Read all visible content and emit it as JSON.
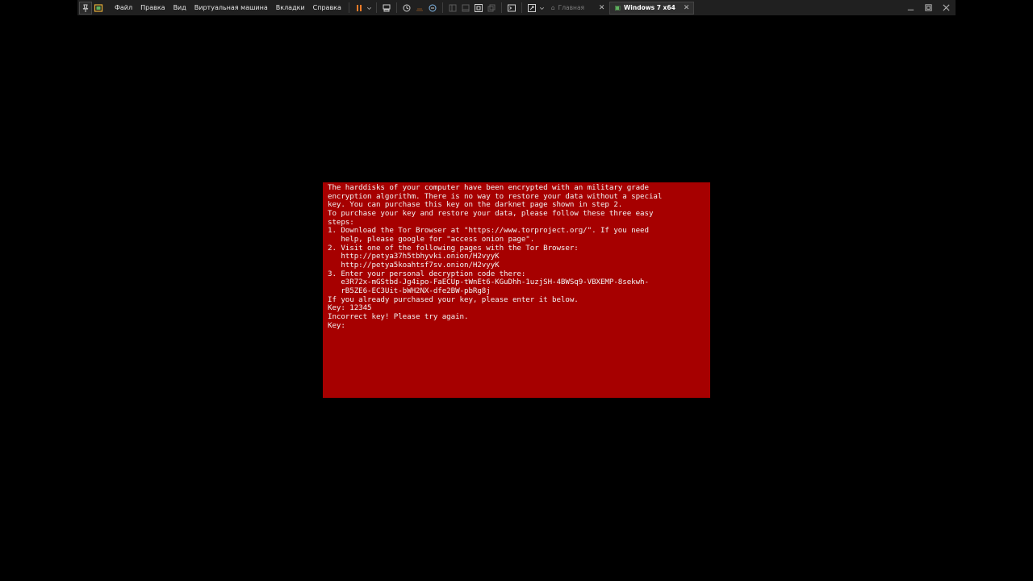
{
  "toolbar": {
    "menu": [
      "Файл",
      "Правка",
      "Вид",
      "Виртуальная машина",
      "Вкладки",
      "Справка"
    ],
    "tabs": [
      {
        "label": "Главная",
        "icon": "home-icon"
      },
      {
        "label": "Windows 7 x64",
        "icon": "vm-icon"
      }
    ]
  },
  "ransom_screen": {
    "lines": [
      "The harddisks of your computer have been encrypted with an military grade",
      "encryption algorithm. There is no way to restore your data without a special",
      "key. You can purchase this key on the darknet page shown in step 2.",
      "",
      "To purchase your key and restore your data, please follow these three easy",
      "steps:",
      "",
      "1. Download the Tor Browser at \"https://www.torproject.org/\". If you need",
      "   help, please google for \"access onion page\".",
      "2. Visit one of the following pages with the Tor Browser:",
      "",
      "   http://petya37h5tbhyvki.onion/H2vyyK",
      "   http://petya5koahtsf7sv.onion/H2vyyK",
      "",
      "3. Enter your personal decryption code there:",
      "",
      "   e3R72x-mGStbd-Jg4ipo-FaECUp-tWnEt6-KGuDhh-1uzjSH-4BWSq9-VBXEMP-8sekwh-",
      "   rB5ZE6-EC3Uit-bWH2NX-dfe2BW-pbRg8j",
      "",
      "If you already purchased your key, please enter it below.",
      "",
      "Key: 12345",
      "Incorrect key! Please try again.",
      "",
      "Key:"
    ]
  }
}
